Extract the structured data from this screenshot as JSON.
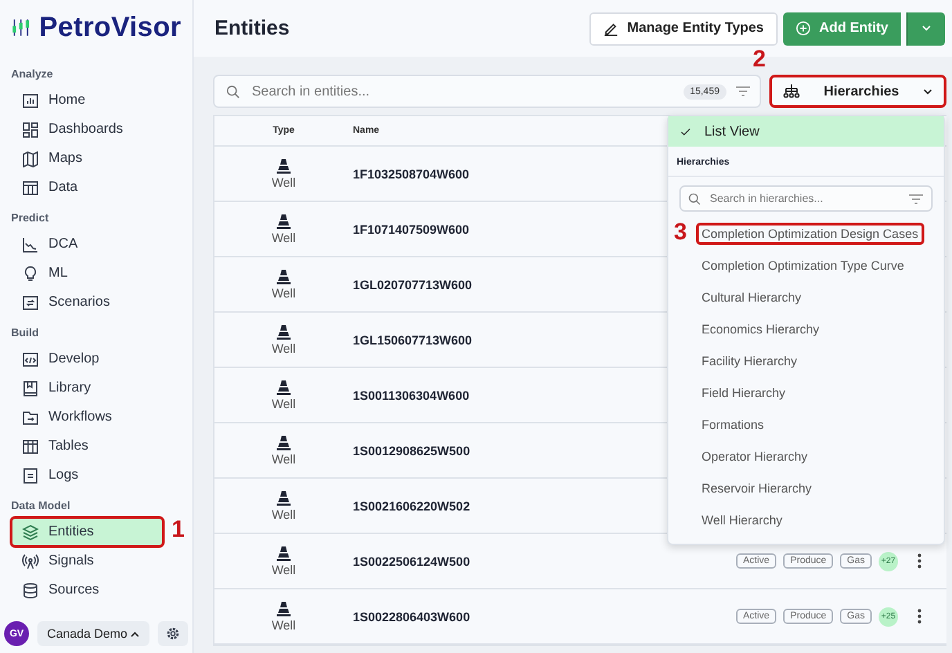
{
  "brand": {
    "name": "PetroVisor"
  },
  "sidebar": {
    "sections": [
      {
        "title": "Analyze",
        "items": [
          {
            "label": "Home",
            "selected": false
          },
          {
            "label": "Dashboards",
            "selected": false
          },
          {
            "label": "Maps",
            "selected": false
          },
          {
            "label": "Data",
            "selected": false
          }
        ]
      },
      {
        "title": "Predict",
        "items": [
          {
            "label": "DCA",
            "selected": false
          },
          {
            "label": "ML",
            "selected": false
          },
          {
            "label": "Scenarios",
            "selected": false
          }
        ]
      },
      {
        "title": "Build",
        "items": [
          {
            "label": "Develop",
            "selected": false
          },
          {
            "label": "Library",
            "selected": false
          },
          {
            "label": "Workflows",
            "selected": false
          },
          {
            "label": "Tables",
            "selected": false
          },
          {
            "label": "Logs",
            "selected": false
          }
        ]
      },
      {
        "title": "Data Model",
        "items": [
          {
            "label": "Entities",
            "selected": true,
            "annotation": "1"
          },
          {
            "label": "Signals",
            "selected": false
          },
          {
            "label": "Sources",
            "selected": false
          }
        ]
      }
    ],
    "footer": {
      "avatar": "GV",
      "workspace": "Canada Demo"
    }
  },
  "header": {
    "title": "Entities",
    "buttons": [
      {
        "label": "Manage Entity Types",
        "kind": "outline"
      },
      {
        "label": "Add Entity",
        "kind": "primary"
      }
    ]
  },
  "search": {
    "placeholder": "Search in entities...",
    "count": "15,459"
  },
  "view_button": {
    "label": "Hierarchies",
    "annotation": "2"
  },
  "table": {
    "columns": [
      "Type",
      "Name"
    ],
    "rows": [
      {
        "type": "Well",
        "name": "1F1032508704W600"
      },
      {
        "type": "Well",
        "name": "1F1071407509W600"
      },
      {
        "type": "Well",
        "name": "1GL020707713W600"
      },
      {
        "type": "Well",
        "name": "1GL150607713W600"
      },
      {
        "type": "Well",
        "name": "1S0011306304W600"
      },
      {
        "type": "Well",
        "name": "1S0012908625W500"
      },
      {
        "type": "Well",
        "name": "1S0021606220W502"
      },
      {
        "type": "Well",
        "name": "1S0022506124W500",
        "tags": [
          "Active",
          "Produce",
          "Gas"
        ],
        "more": "+27"
      },
      {
        "type": "Well",
        "name": "1S0022806403W600",
        "tags": [
          "Active",
          "Produce",
          "Gas"
        ],
        "more": "+25"
      }
    ]
  },
  "view_menu": {
    "options": [
      {
        "label": "List View",
        "selected": true
      }
    ],
    "section": "Hierarchies",
    "search_placeholder": "Search in hierarchies...",
    "items": [
      {
        "label": "Completion Optimization Design Cases",
        "annotation": "3"
      },
      {
        "label": "Completion Optimization Type Curve"
      },
      {
        "label": "Cultural Hierarchy"
      },
      {
        "label": "Economics Hierarchy"
      },
      {
        "label": "Facility Hierarchy"
      },
      {
        "label": "Field Hierarchy"
      },
      {
        "label": "Formations"
      },
      {
        "label": "Operator Hierarchy"
      },
      {
        "label": "Reservoir Hierarchy"
      },
      {
        "label": "Well Hierarchy"
      }
    ]
  }
}
